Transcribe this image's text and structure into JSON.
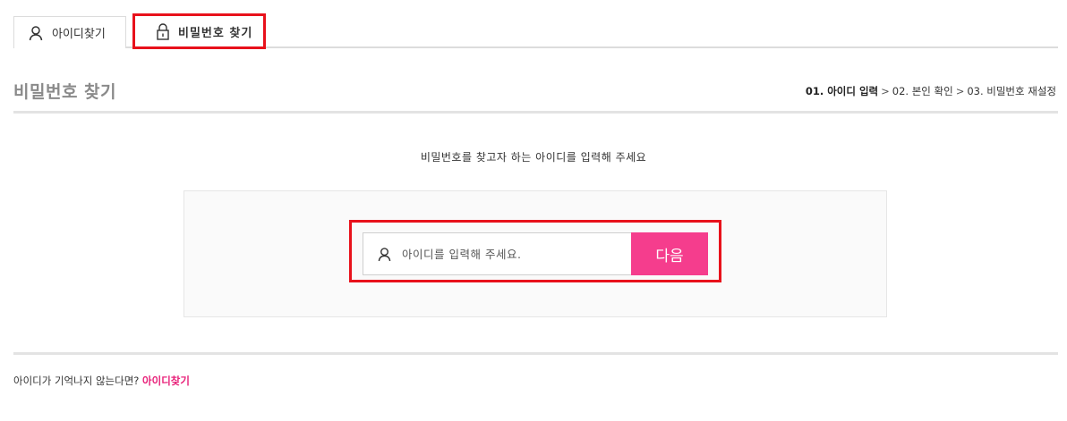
{
  "tabs": {
    "find_id_label": "아이디찾기",
    "find_pw_label": "비밀번호 찾기"
  },
  "title": "비밀번호 찾기",
  "steps": {
    "step1": "01. 아이디 입력",
    "step2": "02. 본인 확인",
    "step3": "03. 비밀번호 재설정",
    "separator": ">"
  },
  "instruction": "비밀번호를 찾고자 하는 아이디를 입력해 주세요",
  "form": {
    "id_placeholder": "아이디를 입력해 주세요.",
    "id_value": "",
    "next_label": "다음"
  },
  "footer": {
    "question": "아이디가 기억나지 않는다면?",
    "link_label": "아이디찾기"
  },
  "colors": {
    "accent_pink": "#f53d8d",
    "link_pink": "#e8227a",
    "highlight_red": "#e8111b"
  },
  "icons": {
    "find_id_tab": "user-icon",
    "find_pw_tab": "lock-icon",
    "id_input": "user-icon"
  }
}
